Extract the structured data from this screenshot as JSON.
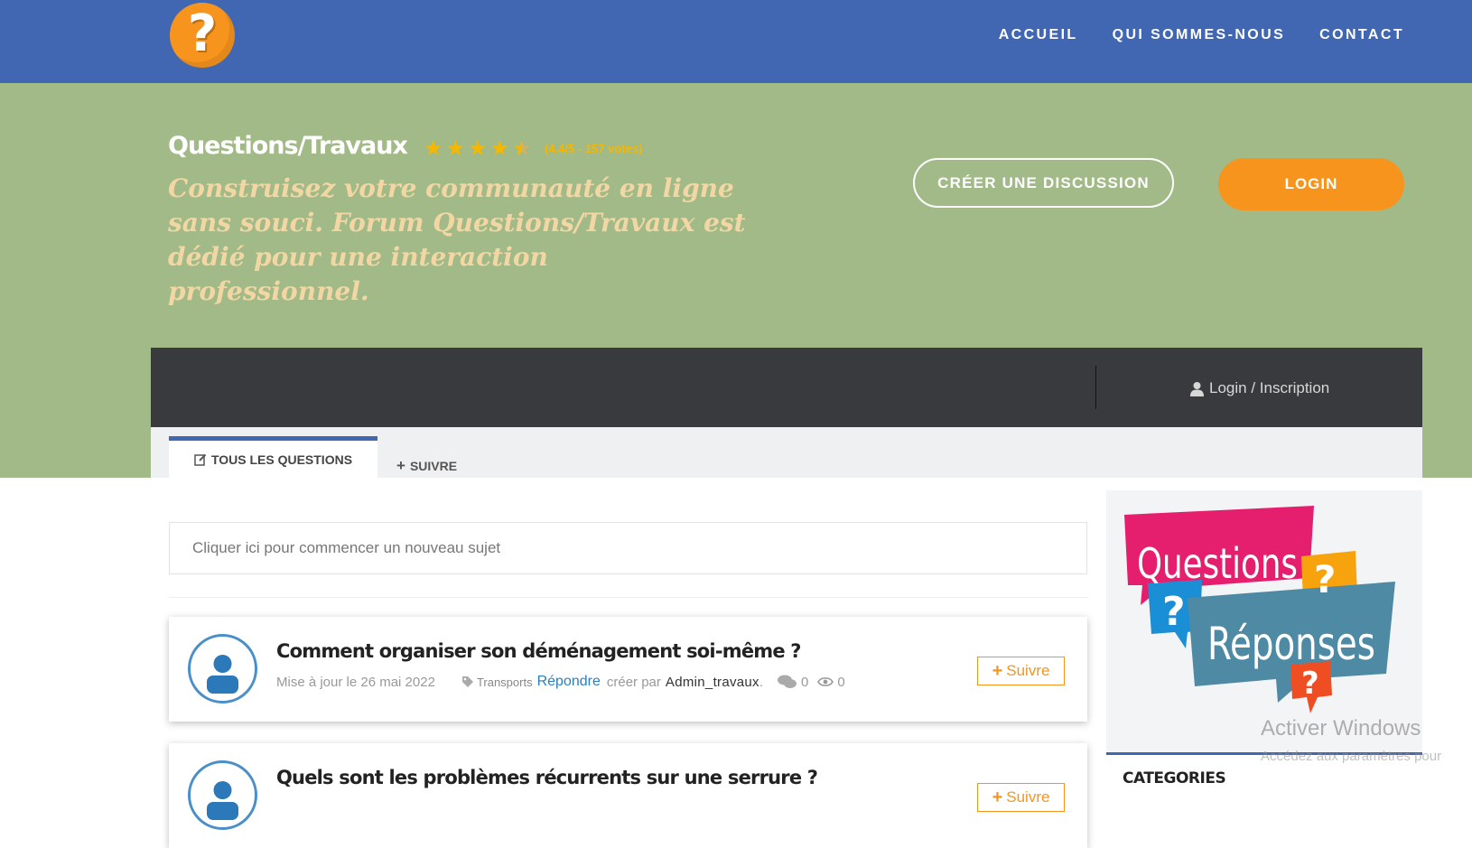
{
  "logo": {
    "glyph": "?",
    "color": "#f7941d"
  },
  "nav": {
    "home": "ACCUEIL",
    "about": "QUI SOMMES-NOUS",
    "contact": "CONTACT"
  },
  "hero": {
    "title": "Questions/Travaux",
    "rating_value": 4.4,
    "rating_text": "(4.4/5 - 157 votes)",
    "tagline": "Construisez votre communauté en ligne sans souci. Forum Questions/Travaux est dédié pour une interaction professionnel.",
    "create_button": "CRÉER UNE DISCUSSION",
    "login_button": "LOGIN"
  },
  "toolbar": {
    "login_link": "Login / Inscription"
  },
  "tabs": {
    "all": "TOUS LES QUESTIONS",
    "follow": "SUIVRE"
  },
  "search": {
    "placeholder": "Cliquer ici pour commencer un nouveau sujet"
  },
  "questions": [
    {
      "title": "Comment organiser son déménagement soi-même ?",
      "updated": "Mise à jour le 26 mai 2022",
      "tag": "Transports",
      "reply": "Répondre",
      "created_by": "créer par",
      "author": "Admin_travaux",
      "comments": "0",
      "views": "0",
      "follow": "Suivre"
    },
    {
      "title": "Quels sont les problèmes récurrents sur une serrure ?",
      "follow": "Suivre"
    }
  ],
  "sidebar": {
    "promo_line1": "Questions",
    "promo_line2": "Réponses",
    "categories_title": "CATEGORIES"
  },
  "watermark": {
    "line1": "Activer Windows",
    "line2": "Accédez aux paramètres pour"
  },
  "colors": {
    "header_blue": "#4267b2",
    "hero_green": "#a2ba87",
    "accent_orange": "#f7941d",
    "dark_bar": "#393a3d",
    "star_gold": "#f5b700"
  }
}
